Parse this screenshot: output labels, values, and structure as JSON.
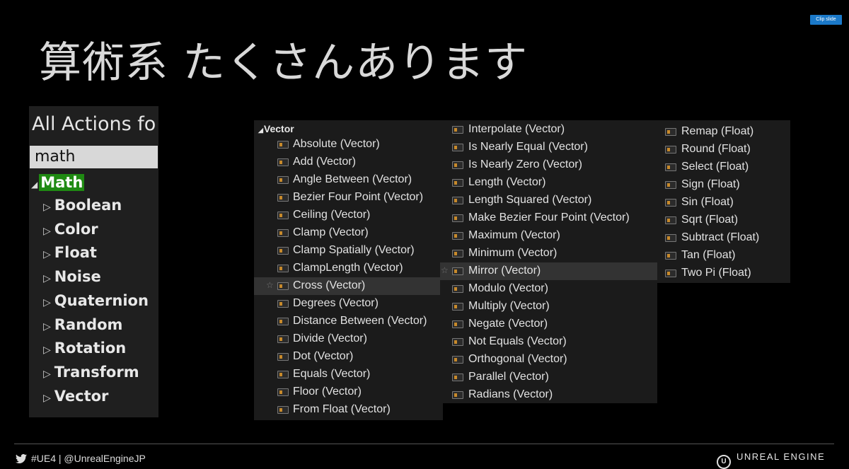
{
  "clip_button": "Clip slide",
  "title": "算術系 たくさんあります",
  "left_panel": {
    "header": "All Actions fo",
    "search_value": "math",
    "root": "Math",
    "items": [
      "Boolean",
      "Color",
      "Float",
      "Noise",
      "Quaternion",
      "Random",
      "Rotation",
      "Transform",
      "Vector"
    ]
  },
  "menu": {
    "category": "Vector",
    "col1": [
      "Absolute (Vector)",
      "Add (Vector)",
      "Angle Between (Vector)",
      "Bezier Four Point (Vector)",
      "Ceiling (Vector)",
      "Clamp (Vector)",
      "Clamp Spatially (Vector)",
      "ClampLength (Vector)",
      "Cross (Vector)",
      "Degrees (Vector)",
      "Distance Between (Vector)",
      "Divide (Vector)",
      "Dot (Vector)",
      "Equals (Vector)",
      "Floor (Vector)",
      "From Float (Vector)"
    ],
    "col2": [
      "Interpolate (Vector)",
      "Is Nearly Equal (Vector)",
      "Is Nearly Zero (Vector)",
      "Length (Vector)",
      "Length Squared (Vector)",
      "Make Bezier Four Point (Vector)",
      "Maximum (Vector)",
      "Minimum (Vector)",
      "Mirror (Vector)",
      "Modulo (Vector)",
      "Multiply (Vector)",
      "Negate (Vector)",
      "Not Equals (Vector)",
      "Orthogonal (Vector)",
      "Parallel (Vector)",
      "Radians (Vector)"
    ],
    "col3": [
      "Remap (Float)",
      "Round (Float)",
      "Select (Float)",
      "Sign (Float)",
      "Sin (Float)",
      "Sqrt (Float)",
      "Subtract (Float)",
      "Tan (Float)",
      "Two Pi (Float)"
    ],
    "col1_selected": 8,
    "col2_selected": 8
  },
  "footer": {
    "hashtag": "#UE4 | @UnrealEngineJP",
    "brand": "UNREAL ENGINE"
  },
  "icons": {
    "tree_collapsed": "triangle-right-icon",
    "tree_expanded": "triangle-down-icon",
    "function": "function-node-icon",
    "favorite": "star-icon",
    "twitter": "twitter-bird-icon",
    "logo": "unreal-engine-logo-icon"
  }
}
